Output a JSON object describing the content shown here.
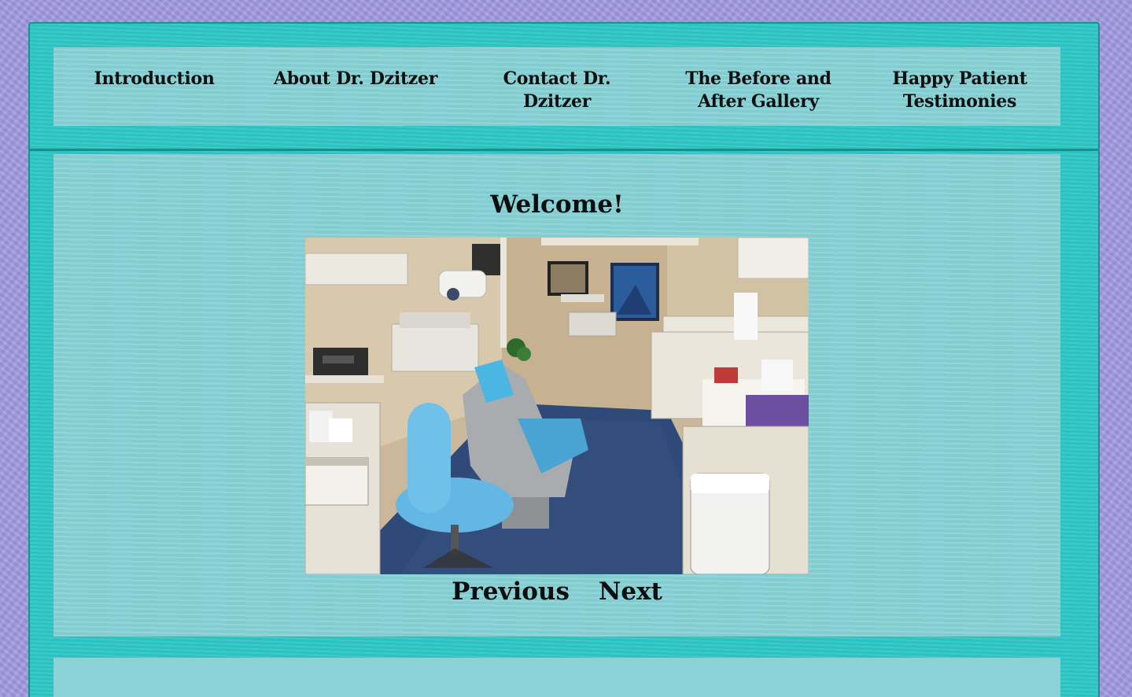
{
  "nav": {
    "items": [
      {
        "label": "Introduction"
      },
      {
        "label": "About Dr. Dzitzer"
      },
      {
        "label": "Contact Dr. Dzitzer"
      },
      {
        "label": "The Before and After Gallery"
      },
      {
        "label": "Happy Patient Testimonies"
      }
    ]
  },
  "main": {
    "heading": "Welcome!",
    "slideshow": {
      "image_subject": "dental-operatory-photo",
      "previous_label": "Previous",
      "next_label": "Next"
    }
  },
  "colors": {
    "page_background": "#9d96d8",
    "frame": "#2ec6c4",
    "panel": "#8ad2d6",
    "text": "#101010"
  }
}
